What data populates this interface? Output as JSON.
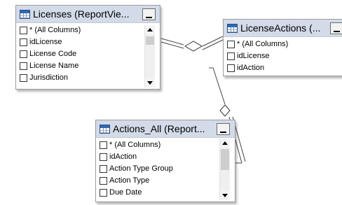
{
  "diagram": {
    "tables": [
      {
        "title": "Licenses (ReportVie...",
        "columns": [
          "* (All Columns)",
          "idLicense",
          "License Code",
          "License Name",
          "Jurisdiction"
        ]
      },
      {
        "title": "LicenseActions (...",
        "columns": [
          "* (All Columns)",
          "idLicense",
          "idAction"
        ]
      },
      {
        "title": "Actions_All (Report...",
        "columns": [
          "* (All Columns)",
          "idAction",
          "Action Type Group",
          "Action Type",
          "Due Date"
        ]
      }
    ],
    "icons": {
      "table": "table-icon",
      "minimize": "minimize-icon",
      "scroll_up": "scroll-up-icon",
      "scroll_down": "scroll-down-icon",
      "relationship": "relationship-diamond-icon"
    }
  }
}
